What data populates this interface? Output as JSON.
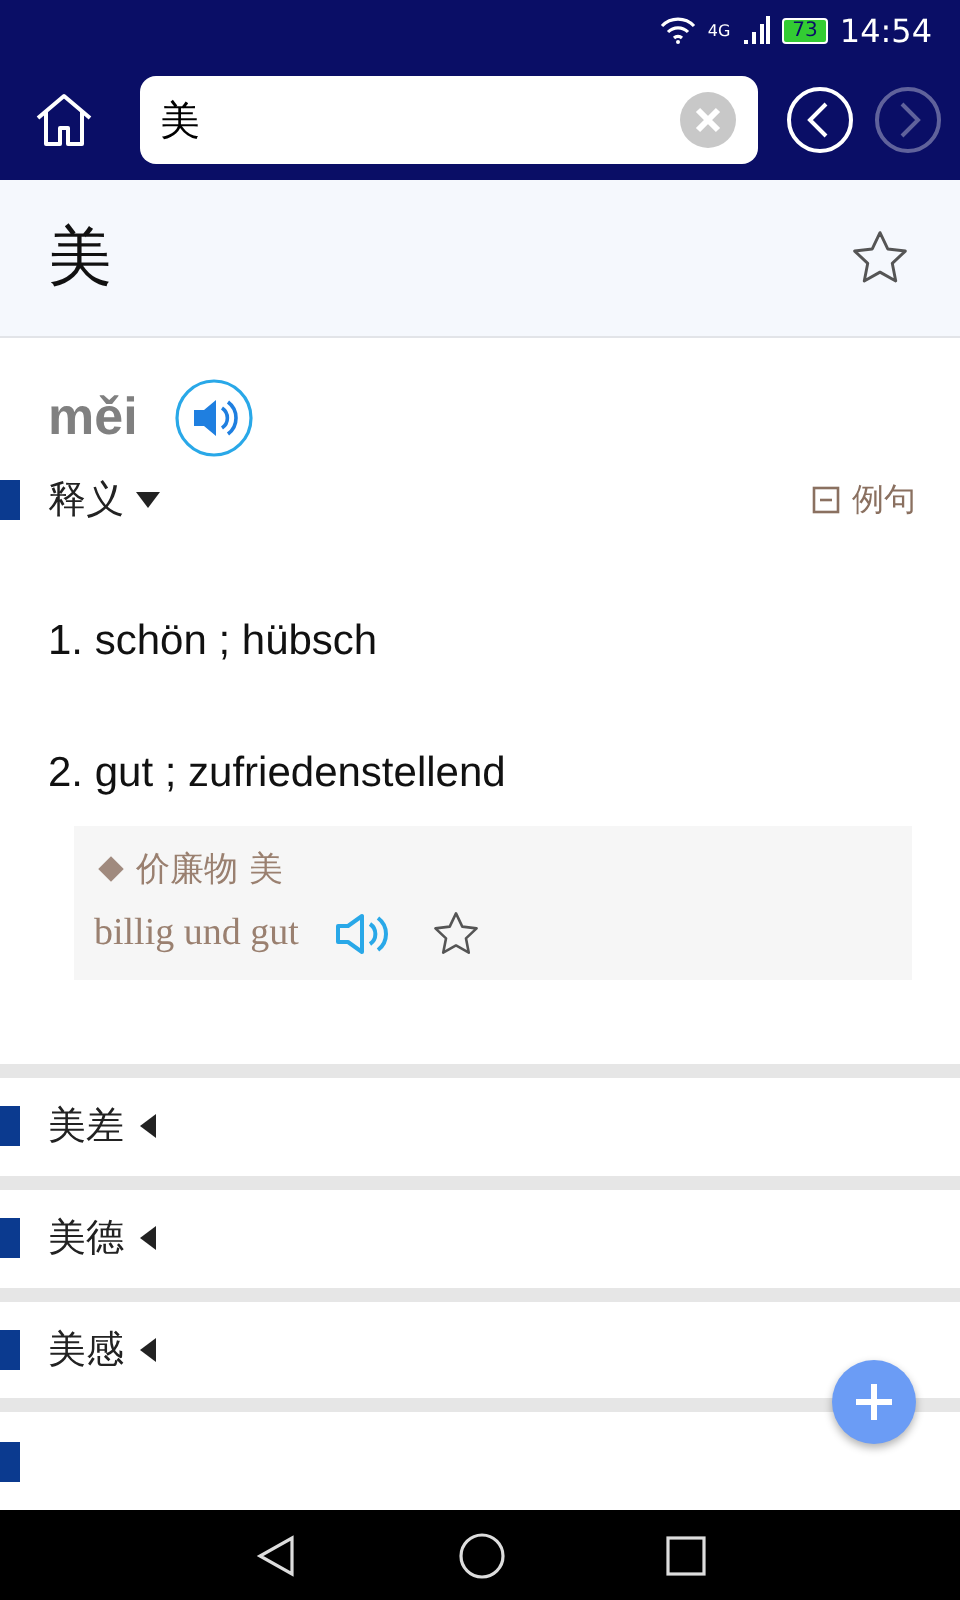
{
  "status_bar": {
    "network": "4G",
    "battery": "73",
    "time": "14:54"
  },
  "toolbar": {
    "search_value": "美",
    "back_disabled": false,
    "forward_disabled": true
  },
  "entry": {
    "headword": "美",
    "starred": false,
    "pinyin": "měi"
  },
  "definition_section": {
    "title": "释义",
    "expanded": true,
    "examples_toggle": "例句",
    "examples_shown": true
  },
  "definitions": [
    {
      "text": "1. schön ; hübsch"
    },
    {
      "text": "2. gut ; zufriedenstellend",
      "examples": [
        {
          "chinese": "价廉物 美",
          "german": "billig und gut",
          "starred": false
        }
      ]
    }
  ],
  "related_words": [
    {
      "word": "美差",
      "expanded": false
    },
    {
      "word": "美德",
      "expanded": false
    },
    {
      "word": "美感",
      "expanded": false
    }
  ]
}
